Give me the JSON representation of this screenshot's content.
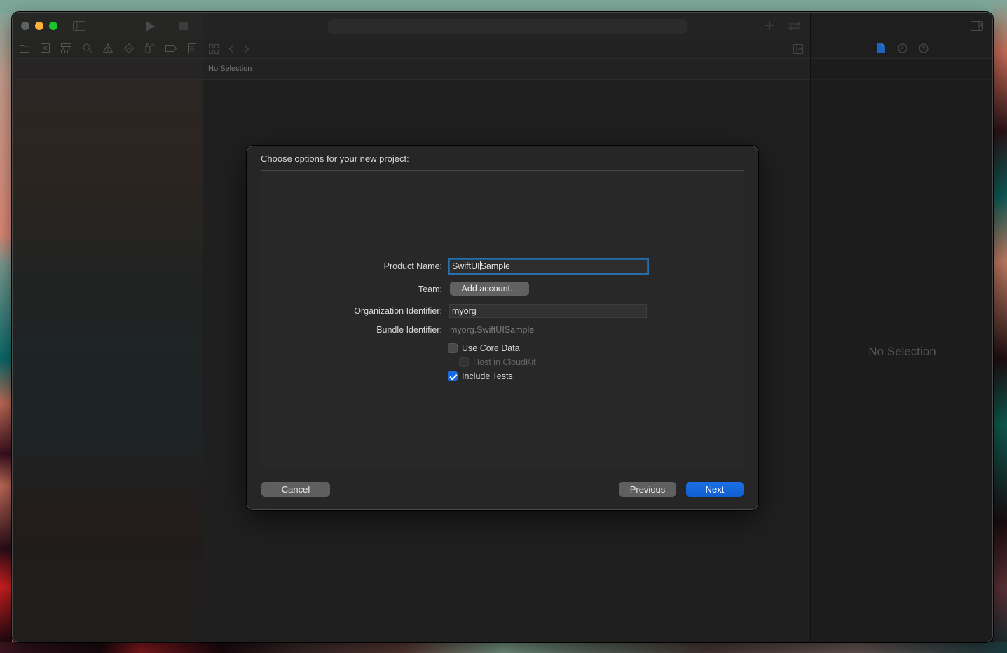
{
  "window": {
    "traffic_lights": {
      "close_color": "#5d6462",
      "minimize_color": "#fdb23a",
      "maximize_color": "#1ec42e"
    }
  },
  "navigator": {
    "toolbar_icons": [
      "folder-icon",
      "source-control-icon",
      "hierarchy-icon",
      "search-icon",
      "warning-icon",
      "test-diamond-icon",
      "debug-spray-icon",
      "breakpoint-tag-icon",
      "report-list-icon"
    ]
  },
  "editor": {
    "path_bar": {
      "text": "No Selection"
    }
  },
  "inspector": {
    "tabs": [
      "file-inspector-icon",
      "history-icon",
      "quick-help-icon"
    ],
    "active_tab_color": "#1e64c0",
    "empty_text": "No Selection"
  },
  "sheet": {
    "title": "Choose options for your new project:",
    "fields": {
      "product_name_label": "Product Name:",
      "product_name_value_before_caret": "SwiftUI",
      "product_name_value_after_caret": "Sample",
      "team_label": "Team:",
      "team_button": "Add account...",
      "org_id_label": "Organization Identifier:",
      "org_id_value": "myorg",
      "bundle_id_label": "Bundle Identifier:",
      "bundle_id_value": "myorg.SwiftUISample"
    },
    "checkboxes": {
      "use_core_data": {
        "label": "Use Core Data",
        "checked": false
      },
      "host_in_cloudkit": {
        "label": "Host in CloudKit",
        "checked": false,
        "disabled": true
      },
      "include_tests": {
        "label": "Include Tests",
        "checked": true
      }
    },
    "buttons": {
      "cancel": "Cancel",
      "previous": "Previous",
      "next": "Next"
    },
    "accent_color": "#1a6be0"
  }
}
